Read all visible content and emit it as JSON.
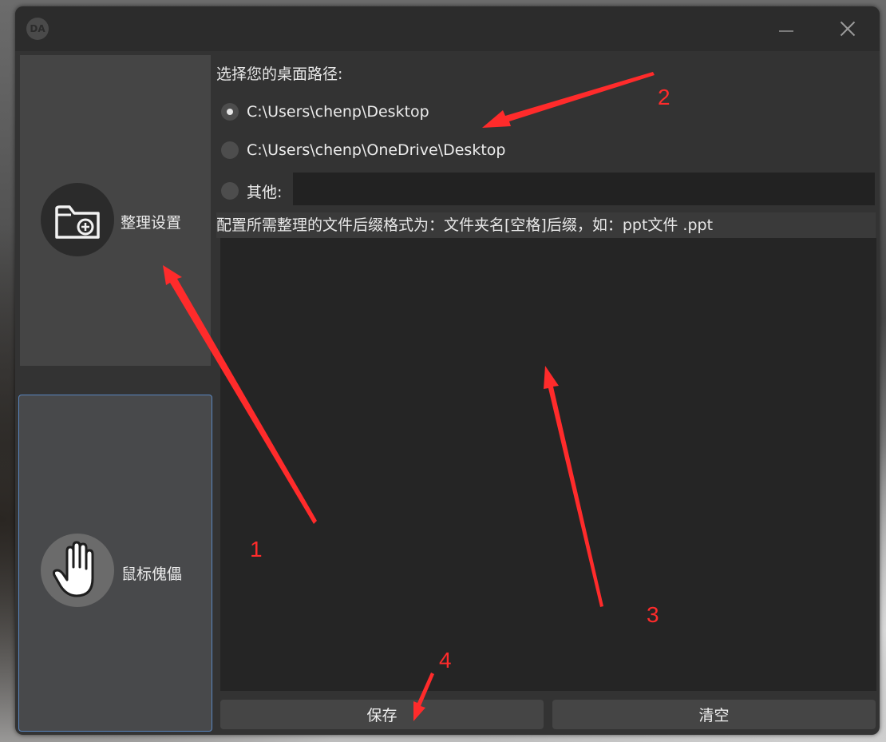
{
  "window": {
    "app_icon_text": "DA",
    "minimize_icon": "minimize-icon",
    "close_icon": "close-icon"
  },
  "sidebar": {
    "items": [
      {
        "label": "整理设置",
        "icon": "folder-add-icon"
      },
      {
        "label": "鼠标傀儡",
        "icon": "hand-icon"
      }
    ]
  },
  "main": {
    "prompt": "选择您的桌面路径:",
    "options": [
      {
        "label": "C:\\Users\\chenp\\Desktop",
        "checked": true
      },
      {
        "label": "C:\\Users\\chenp\\OneDrive\\Desktop",
        "checked": false
      },
      {
        "label": "其他:",
        "checked": false
      }
    ],
    "other_value": "",
    "hint": "配置所需整理的文件后缀格式为：文件夹名[空格]后缀，如：ppt文件 .ppt",
    "textarea_value": "",
    "save_label": "保存",
    "clear_label": "清空"
  },
  "annotations": {
    "color": "#ff2b2b",
    "labels": [
      "1",
      "2",
      "3",
      "4"
    ]
  }
}
